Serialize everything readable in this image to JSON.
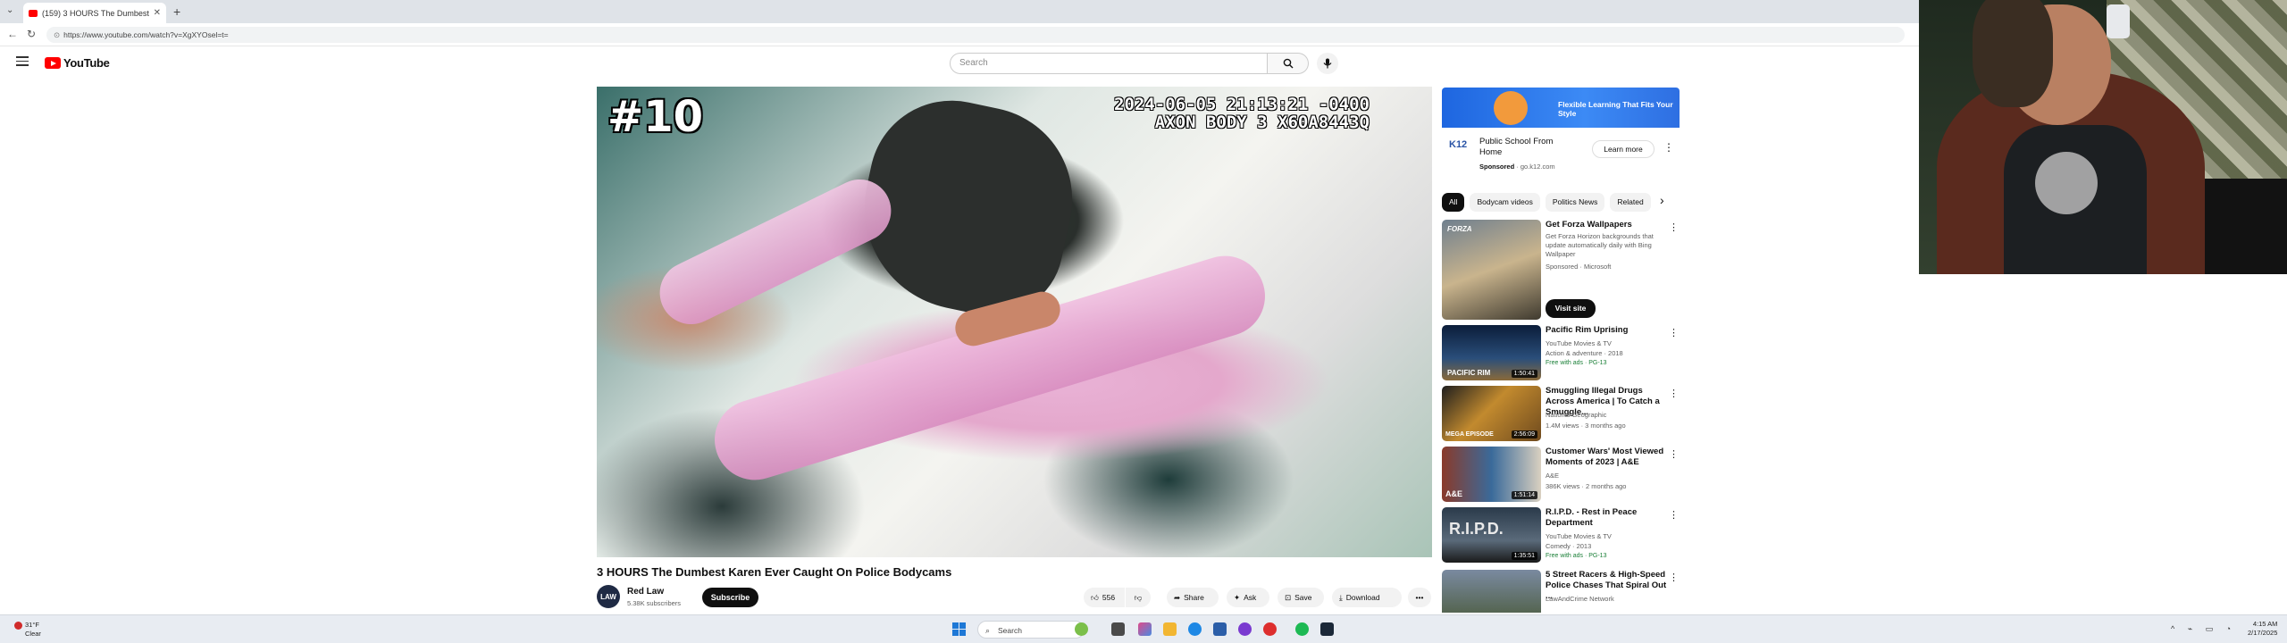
{
  "browser": {
    "tab_title": "(159) 3 HOURS The Dumbest",
    "url": "https://www.youtube.com/watch?v=XgXYOsel=t="
  },
  "youtube": {
    "logo_text": "YouTube",
    "search_placeholder": "Search"
  },
  "player": {
    "episode_number": "#10",
    "timestamp": "2024-06-05 21:13:21 -0400",
    "device": "AXON BODY 3 X60A8443Q"
  },
  "video": {
    "title": "3 HOURS The Dumbest Karen Ever Caught On Police Bodycams",
    "channel": "Red Law",
    "channel_avatar_text": "LAW",
    "subscribers": "5.38K subscribers",
    "subscribe_label": "Subscribe",
    "like_count": "556",
    "share_label": "Share",
    "ask_label": "Ask",
    "save_label": "Save",
    "download_label": "Download"
  },
  "ad": {
    "banner_tagline": "Flexible Learning That Fits Your Style",
    "logo": "K12",
    "title": "Public School From Home",
    "sponsored_label": "Sponsored",
    "domain": "go.k12.com",
    "cta": "Learn more"
  },
  "chips": [
    "All",
    "Bodycam videos",
    "Politics News",
    "Related"
  ],
  "recommendations": [
    {
      "title": "Get Forza Wallpapers",
      "desc": "Get Forza Horizon backgrounds that update automatically daily with Bing Wallpaper",
      "sponsor": "Sponsored · Microsoft",
      "cta": "Visit site",
      "thumb_text": "FORZA"
    },
    {
      "title": "Pacific Rim Uprising",
      "channel": "YouTube Movies & TV",
      "meta": "Action & adventure · 2018",
      "badge": "Free with ads · PG-13",
      "duration": "1:50:41",
      "thumb_text": "PACIFIC RIM"
    },
    {
      "title": "Smuggling Illegal Drugs Across America | To Catch a Smuggle...",
      "channel": "National Geographic",
      "meta": "1.4M views · 3 months ago",
      "duration": "2:56:09",
      "thumb_text": "MEGA EPISODE"
    },
    {
      "title": "Customer Wars' Most Viewed Moments of 2023 | A&E",
      "channel": "A&E",
      "meta": "386K views · 2 months ago",
      "duration": "1:51:14",
      "thumb_text": "A&E"
    },
    {
      "title": "R.I.P.D. - Rest in Peace Department",
      "channel": "YouTube Movies & TV",
      "meta": "Comedy · 2013",
      "badge": "Free with ads · PG-13",
      "duration": "1:35:51",
      "thumb_text": "R.I.P.D."
    },
    {
      "title": "5 Street Racers & High-Speed Police Chases That Spiral Out ...",
      "channel": "LawAndCrime Network",
      "meta": "",
      "duration": "",
      "thumb_text": ""
    }
  ],
  "taskbar": {
    "weather_temp": "31°F",
    "weather_desc": "Clear",
    "search_label": "Search",
    "time": "4:15 AM",
    "date": "2/17/2025"
  },
  "colors": {
    "youtube_red": "#ff0000",
    "accent_blue": "#1e66e0"
  }
}
